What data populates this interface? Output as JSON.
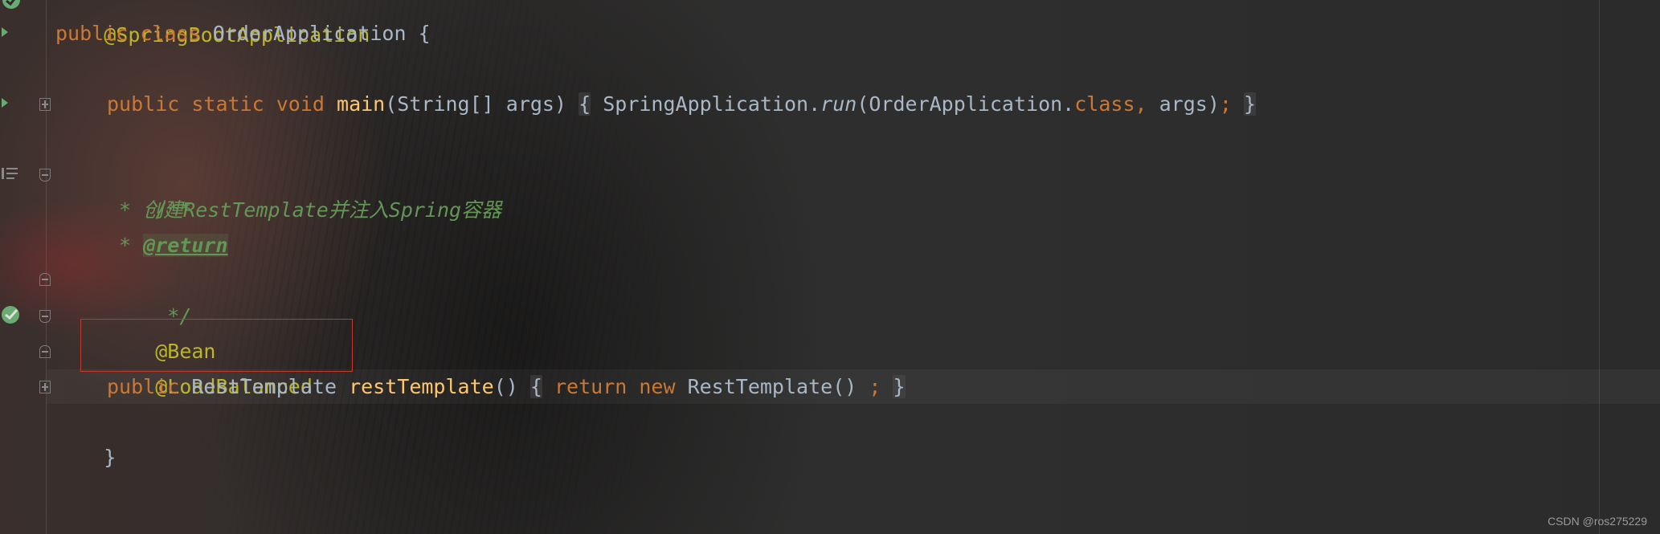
{
  "editor": {
    "lines": {
      "l1_annotation": "@SpringBootApplication",
      "l2": {
        "kw1": "public",
        "kw2": "class",
        "name": "OrderApplication",
        "brace": "{"
      },
      "l4": {
        "kw1": "public",
        "kw2": "static",
        "kw3": "void",
        "fn": "main",
        "params": "(String[] args)",
        "fold_open": "{",
        "call_cls": "SpringApplication.",
        "call_fn": "run",
        "call_open": "(OrderApplication.",
        "call_kw": "class,",
        "call_rest": " args)",
        "semi": ";",
        "fold_close": "}"
      },
      "l6_comment_open": "/**",
      "l7": {
        "star": " * ",
        "text": "创建RestTemplate并注入Spring容器"
      },
      "l8": {
        "star": " * ",
        "tag": "@return"
      },
      "l9_comment_close": " */",
      "l10_annotation": "@Bean",
      "l11_annotation": "@LoadBalanced",
      "l12": {
        "kw1": "public",
        "type": "RestTemplate",
        "fn": "restTemplate",
        "params": "()",
        "fold_open": "{",
        "kw_return": "return",
        "kw_new": "new",
        "ctor": "RestTemplate()",
        "semi": ";",
        "fold_close": "}"
      },
      "l13_brace": "}"
    }
  },
  "watermark": "CSDN @ros275229",
  "colors": {
    "keyword": "#cc7832",
    "function": "#ffc66d",
    "annotation": "#bbb529",
    "comment": "#629755",
    "text": "#a9b7c6",
    "highlight_box": "#c0392b"
  },
  "icons": [
    "spring-bean-run-icon",
    "fold-collapse-icon",
    "fold-expand-icon",
    "structure-list-icon"
  ]
}
